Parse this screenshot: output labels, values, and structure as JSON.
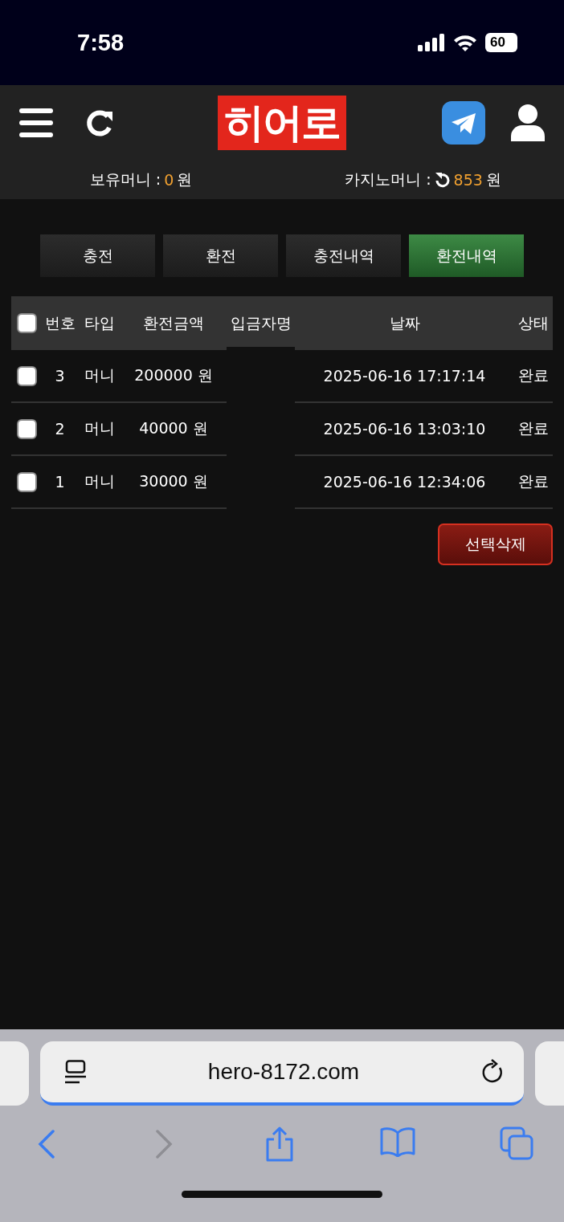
{
  "status_bar": {
    "time": "7:58",
    "battery": "60"
  },
  "header": {
    "logo": "히어로"
  },
  "balances": [
    {
      "kind": "wallet",
      "label": "보유머니 :",
      "value": "0",
      "unit": "원"
    },
    {
      "kind": "casino",
      "label": "카지노머니 :",
      "value": "853",
      "unit": "원"
    }
  ],
  "tabs": [
    {
      "label": "충전",
      "selected": false
    },
    {
      "label": "환전",
      "selected": false
    },
    {
      "label": "충전내역",
      "selected": false
    },
    {
      "label": "환전내역",
      "selected": true
    }
  ],
  "table": {
    "select_all": {
      "checked": false
    },
    "columns": [
      "번호",
      "타입",
      "환전금액",
      "입금자명",
      "날짜",
      "상태"
    ],
    "rows": [
      {
        "checked": false,
        "no": "3",
        "type": "머니",
        "amount": "200000 원",
        "date": "2025-06-16 17:17:14",
        "status": "완료"
      },
      {
        "checked": false,
        "no": "2",
        "type": "머니",
        "amount": "40000 원",
        "date": "2025-06-16 13:03:10",
        "status": "완료"
      },
      {
        "checked": false,
        "no": "1",
        "type": "머니",
        "amount": "30000 원",
        "date": "2025-06-16 12:34:06",
        "status": "완료"
      }
    ]
  },
  "delete_button": "선택삭제",
  "browser": {
    "url": "hero-8172.com",
    "back": {
      "disabled": false
    },
    "forward": {
      "disabled": true
    }
  }
}
